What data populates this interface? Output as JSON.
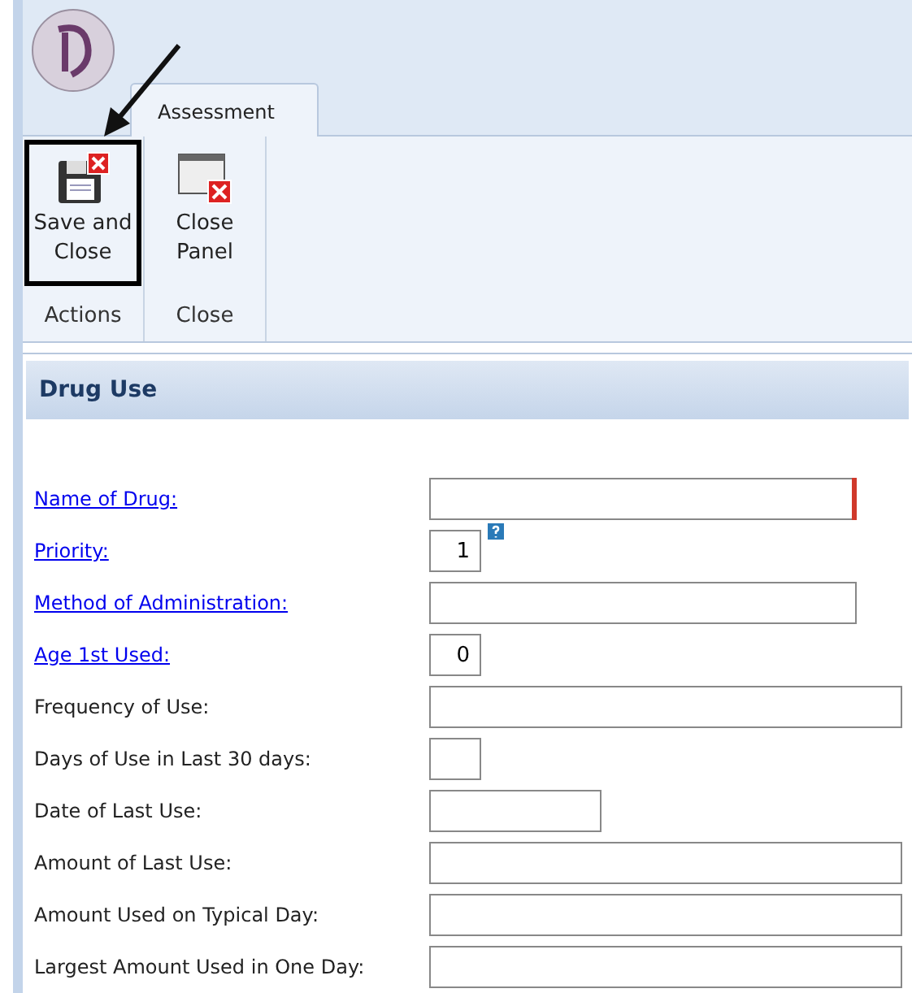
{
  "ribbon": {
    "tabs": [
      {
        "label": "Assessment",
        "selected": true
      }
    ],
    "groups": [
      {
        "label": "Actions",
        "buttons": [
          {
            "label": "Save and Close",
            "kind": "save",
            "highlighted": true
          }
        ]
      },
      {
        "label": "Close",
        "buttons": [
          {
            "label": "Close Panel",
            "kind": "panel",
            "highlighted": false
          }
        ]
      }
    ]
  },
  "panel": {
    "title": "Drug Use"
  },
  "fields": [
    {
      "label": "Name of Drug:",
      "link": true,
      "kind": "medium",
      "required": true,
      "help": false
    },
    {
      "label": "Priority:",
      "link": true,
      "kind": "small",
      "value": "1",
      "required": false,
      "help": true
    },
    {
      "label": "Method of Administration:",
      "link": true,
      "kind": "medium",
      "required": false,
      "help": false
    },
    {
      "label": "Age 1st Used:",
      "link": true,
      "kind": "small",
      "value": "0",
      "required": false,
      "help": false
    },
    {
      "label": "Frequency of Use:",
      "link": false,
      "kind": "wide",
      "required": false,
      "help": false
    },
    {
      "label": "Days of Use in Last 30 days:",
      "link": false,
      "kind": "small",
      "required": false,
      "help": false
    },
    {
      "label": "Date of Last Use:",
      "link": false,
      "kind": "date",
      "required": false,
      "help": false
    },
    {
      "label": "Amount of Last Use:",
      "link": false,
      "kind": "wide",
      "required": false,
      "help": false
    },
    {
      "label": "Amount Used on Typical Day:",
      "link": false,
      "kind": "wide",
      "required": false,
      "help": false
    },
    {
      "label": "Largest Amount Used in One Day:",
      "link": false,
      "kind": "wide",
      "required": false,
      "help": false
    }
  ]
}
